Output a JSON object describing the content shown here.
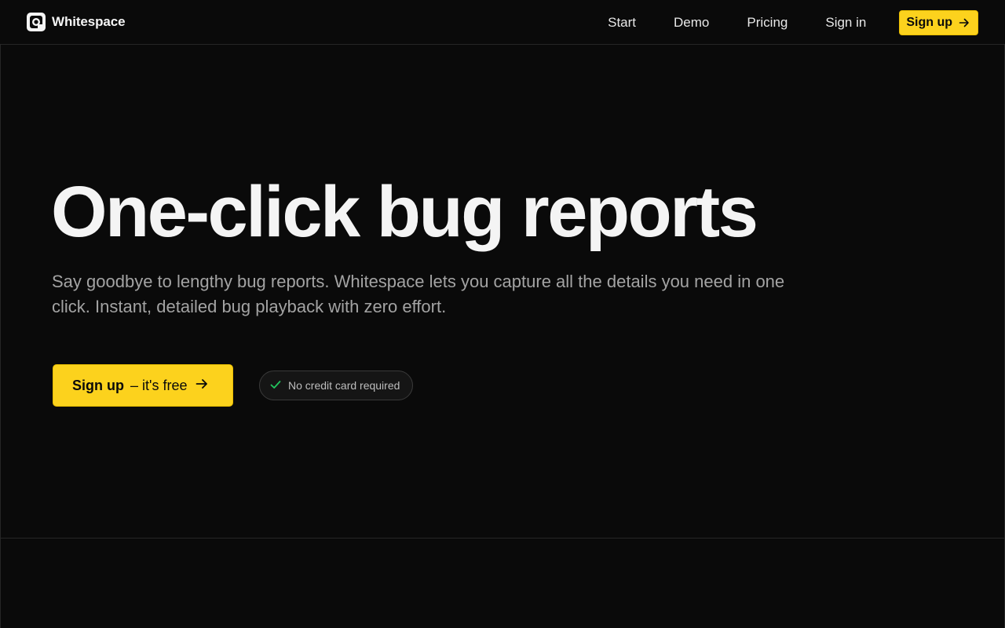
{
  "brand": {
    "name": "Whitespace",
    "icon": "whitespace-logo-icon"
  },
  "nav": {
    "items": [
      "Start",
      "Demo",
      "Pricing",
      "Sign in"
    ],
    "signup_label": "Sign up",
    "signup_icon": "arrow-right-icon"
  },
  "hero": {
    "headline": "One-click bug reports",
    "subtext": "Say goodbye to lengthy bug reports. Whitespace lets you capture all the details you need in one click. Instant, detailed bug playback with zero effort.",
    "cta_strong": "Sign up",
    "cta_rest": "– it's free",
    "cta_icon": "arrow-right-icon",
    "badge_text": "No credit card required",
    "badge_icon": "checkmark-icon"
  },
  "colors": {
    "background": "#0a0a0a",
    "accent": "#fcd21d",
    "border": "#262626",
    "check": "#22c55e"
  }
}
